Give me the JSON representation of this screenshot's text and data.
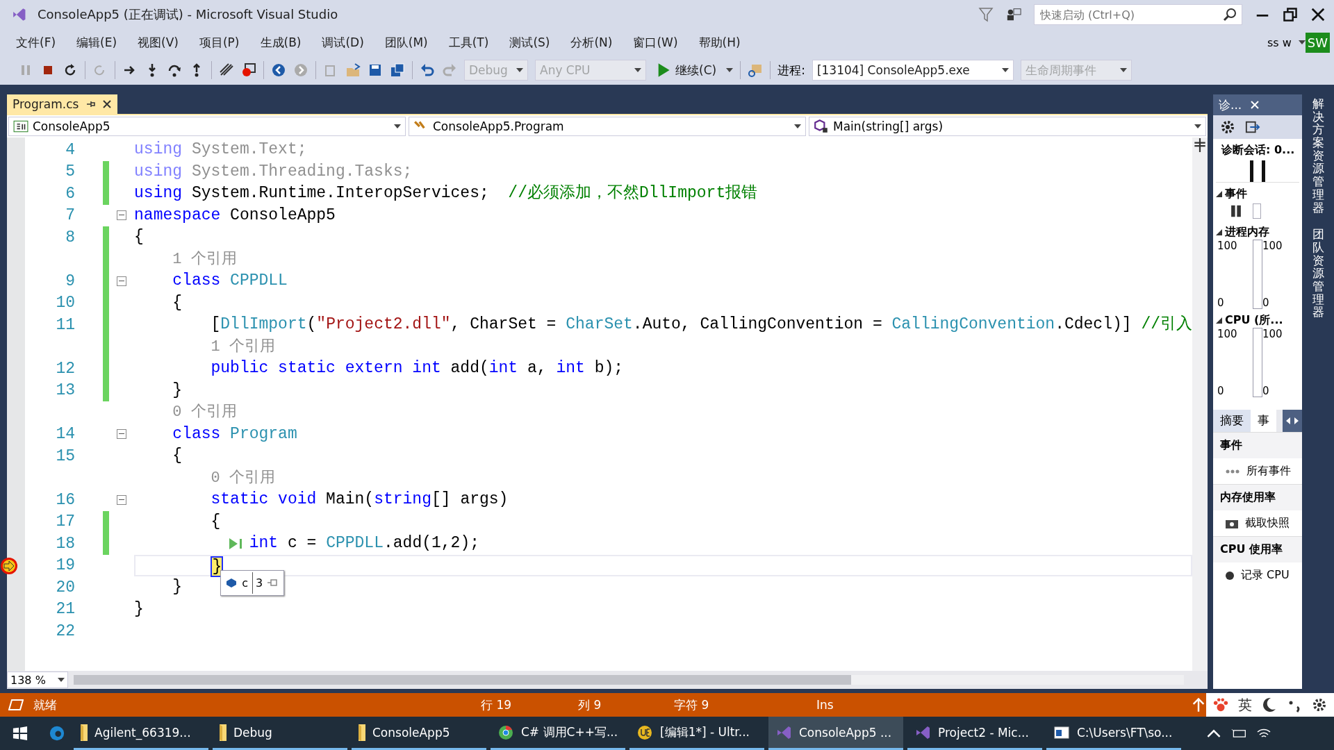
{
  "window": {
    "title": "ConsoleApp5 (正在调试) - Microsoft Visual Studio",
    "search_placeholder": "快速启动 (Ctrl+Q)",
    "user": "ss w",
    "user_badge": "SW"
  },
  "menu": [
    "文件(F)",
    "编辑(E)",
    "视图(V)",
    "项目(P)",
    "生成(B)",
    "调试(D)",
    "团队(M)",
    "工具(T)",
    "测试(S)",
    "分析(N)",
    "窗口(W)",
    "帮助(H)"
  ],
  "toolbar": {
    "configuration": {
      "value": "Debug",
      "disabled": true
    },
    "platform": {
      "value": "Any CPU",
      "disabled": true
    },
    "continue_button": "继续(C)",
    "process_label": "进程:",
    "process": {
      "value": "[13104] ConsoleApp5.exe",
      "disabled": false
    },
    "lifecycle": {
      "value": "生命周期事件",
      "disabled": true
    }
  },
  "tabs": [
    {
      "label": "Program.cs",
      "selected": true
    }
  ],
  "nav": [
    "ConsoleApp5",
    "ConsoleApp5.Program",
    "Main(string[] args)"
  ],
  "lines": [
    {
      "kind": "code",
      "no": "4",
      "changed": false,
      "fold": false,
      "current": false,
      "tokens": [
        {
          "kind": "kwdim",
          "text": "using"
        },
        {
          "kind": "dim",
          "text": " System.Text;"
        }
      ]
    },
    {
      "kind": "code",
      "no": "5",
      "changed": true,
      "fold": false,
      "current": false,
      "tokens": [
        {
          "kind": "kwdim",
          "text": "using"
        },
        {
          "kind": "dim",
          "text": " System.Threading.Tasks;"
        }
      ]
    },
    {
      "kind": "code",
      "no": "6",
      "changed": true,
      "fold": false,
      "current": false,
      "tokens": [
        {
          "kind": "kw",
          "text": "using"
        },
        {
          "kind": "txt",
          "text": " System.Runtime.InteropServices;  "
        },
        {
          "kind": "cmt",
          "text": "//必须添加，不然DllImport报错"
        }
      ]
    },
    {
      "kind": "code",
      "no": "7",
      "changed": false,
      "fold": true,
      "current": false,
      "tokens": [
        {
          "kind": "kw",
          "text": "namespace"
        },
        {
          "kind": "txt",
          "text": " ConsoleApp5"
        }
      ]
    },
    {
      "kind": "code",
      "no": "8",
      "changed": true,
      "fold": false,
      "current": false,
      "tokens": [
        {
          "kind": "txt",
          "text": "{"
        }
      ]
    },
    {
      "kind": "refs",
      "changed": true,
      "text": "    1 个引用"
    },
    {
      "kind": "code",
      "no": "9",
      "changed": true,
      "fold": true,
      "current": false,
      "tokens": [
        {
          "kind": "kw",
          "text": "    class"
        },
        {
          "kind": "type",
          "text": " CPPDLL"
        }
      ]
    },
    {
      "kind": "code",
      "no": "10",
      "changed": true,
      "fold": false,
      "current": false,
      "tokens": [
        {
          "kind": "txt",
          "text": "    {"
        }
      ]
    },
    {
      "kind": "code",
      "no": "11",
      "changed": true,
      "fold": false,
      "current": false,
      "tokens": [
        {
          "kind": "txt",
          "text": "        ["
        },
        {
          "kind": "type",
          "text": "DllImport"
        },
        {
          "kind": "txt",
          "text": "("
        },
        {
          "kind": "str",
          "text": "\"Project2.dll\""
        },
        {
          "kind": "txt",
          "text": ", CharSet = "
        },
        {
          "kind": "type",
          "text": "CharSet"
        },
        {
          "kind": "txt",
          "text": ".Auto, CallingConvention = "
        },
        {
          "kind": "type",
          "text": "CallingConvention"
        },
        {
          "kind": "txt",
          "text": ".Cdecl)] "
        },
        {
          "kind": "cmt",
          "text": "//引入"
        }
      ]
    },
    {
      "kind": "refs",
      "changed": true,
      "text": "        1 个引用"
    },
    {
      "kind": "code",
      "no": "12",
      "changed": true,
      "fold": false,
      "current": false,
      "tokens": [
        {
          "kind": "kw",
          "text": "        public static extern int"
        },
        {
          "kind": "txt",
          "text": " add("
        },
        {
          "kind": "kw",
          "text": "int"
        },
        {
          "kind": "txt",
          "text": " a, "
        },
        {
          "kind": "kw",
          "text": "int"
        },
        {
          "kind": "txt",
          "text": " b);"
        }
      ]
    },
    {
      "kind": "code",
      "no": "13",
      "changed": true,
      "fold": false,
      "current": false,
      "tokens": [
        {
          "kind": "txt",
          "text": "    }"
        }
      ]
    },
    {
      "kind": "refs",
      "changed": false,
      "text": "    0 个引用"
    },
    {
      "kind": "code",
      "no": "14",
      "changed": false,
      "fold": true,
      "current": false,
      "tokens": [
        {
          "kind": "kw",
          "text": "    class"
        },
        {
          "kind": "type",
          "text": " Program"
        }
      ]
    },
    {
      "kind": "code",
      "no": "15",
      "changed": false,
      "fold": false,
      "current": false,
      "tokens": [
        {
          "kind": "txt",
          "text": "    {"
        }
      ]
    },
    {
      "kind": "refs",
      "changed": false,
      "text": "        0 个引用"
    },
    {
      "kind": "code",
      "no": "16",
      "changed": false,
      "fold": true,
      "current": false,
      "tokens": [
        {
          "kind": "kw",
          "text": "        static void"
        },
        {
          "kind": "txt",
          "text": " Main("
        },
        {
          "kind": "kw",
          "text": "string"
        },
        {
          "kind": "txt",
          "text": "[] args)"
        }
      ]
    },
    {
      "kind": "code",
      "no": "17",
      "changed": true,
      "fold": false,
      "current": false,
      "tokens": [
        {
          "kind": "txt",
          "text": "        {"
        }
      ]
    },
    {
      "kind": "code",
      "no": "18",
      "changed": true,
      "fold": false,
      "current": false,
      "run_to_cursor": true,
      "tokens": [
        {
          "kind": "kw",
          "text": "            int"
        },
        {
          "kind": "txt",
          "text": " c = "
        },
        {
          "kind": "type",
          "text": "CPPDLL"
        },
        {
          "kind": "txt",
          "text": ".add(1,2);"
        }
      ]
    },
    {
      "kind": "code",
      "no": "19",
      "changed": false,
      "fold": false,
      "current": true,
      "tokens": [
        {
          "kind": "txt",
          "text": "        }"
        }
      ],
      "datatip": {
        "name": "c",
        "value": "3"
      }
    },
    {
      "kind": "code",
      "no": "20",
      "changed": false,
      "fold": false,
      "current": false,
      "tokens": [
        {
          "kind": "txt",
          "text": "    }"
        }
      ]
    },
    {
      "kind": "code",
      "no": "21",
      "changed": false,
      "fold": false,
      "current": false,
      "tokens": [
        {
          "kind": "txt",
          "text": "}"
        }
      ]
    },
    {
      "kind": "code",
      "no": "22",
      "changed": false,
      "fold": false,
      "current": false
    }
  ],
  "zoom": "138 %",
  "diagnostics": {
    "title": "诊...",
    "session": "诊断会话: 0...",
    "events_title": "事件",
    "memory_title": "进程内存",
    "memory_axis": [
      "100",
      "100",
      "0",
      "0"
    ],
    "cpu_title": "CPU (所...",
    "cpu_axis": [
      "100",
      "100",
      "0",
      "0"
    ],
    "tabs": [
      {
        "label": "摘要",
        "selected": true
      },
      {
        "label": "事",
        "selected": false
      }
    ],
    "sections": [
      {
        "title": "事件",
        "action": "所有事件"
      },
      {
        "title": "内存使用率",
        "action": "截取快照"
      },
      {
        "title": "CPU 使用率",
        "action": "记录 CPU"
      }
    ]
  },
  "side_tabs": [
    "解决方案资源管理器",
    "团队资源管理器"
  ],
  "status_bar": {
    "state": "就绪",
    "line": "行 19",
    "column": "列 9",
    "char": "字符 9",
    "mode": "Ins"
  },
  "ime": "英",
  "taskbar": [
    {
      "kind": "folder",
      "label": "Agilent_66319...",
      "selected": false
    },
    {
      "kind": "folder",
      "label": "Debug",
      "selected": false
    },
    {
      "kind": "folder",
      "label": "ConsoleApp5",
      "selected": false
    },
    {
      "kind": "browser",
      "label": "C# 调用C++写...",
      "selected": false
    },
    {
      "kind": "editor",
      "label": "[编辑1*] - Ultr...",
      "selected": false
    },
    {
      "kind": "ide",
      "label": "ConsoleApp5 ...",
      "selected": true
    },
    {
      "kind": "ide",
      "label": "Project2 - Mic...",
      "selected": false
    },
    {
      "kind": "terminal",
      "label": "C:\\Users\\FT\\so...",
      "selected": false
    }
  ]
}
